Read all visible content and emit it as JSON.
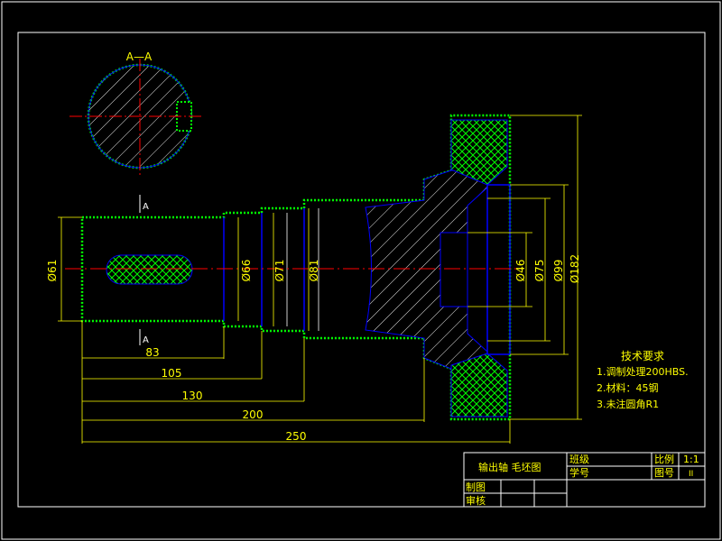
{
  "colors": {
    "background": "#000000",
    "frame": "#ffffff",
    "outline": "#0000ff",
    "fill_hatch": "#ffffff",
    "fill_border": "#00ff00",
    "center_line": "#ff0000",
    "dimension": "#ffff00",
    "title_text": "#ffff00",
    "note_text": "#ffff00"
  },
  "section_view": {
    "label": "A—A"
  },
  "cut_marks": {
    "top_label": "A",
    "bottom_label": "A"
  },
  "diameters": {
    "d61": "Ø61",
    "d66": "Ø66",
    "d71": "Ø71",
    "d81": "Ø81",
    "d46": "Ø46",
    "d75": "Ø75",
    "d99": "Ø99",
    "d182": "Ø182"
  },
  "lengths": {
    "l83": "83",
    "l105": "105",
    "l130": "130",
    "l200": "200",
    "l250": "250"
  },
  "tech_notes": {
    "title": "技术要求",
    "items": [
      "1.调制处理200HBS.",
      "2.材料：45钢",
      "3.未注圆角R1"
    ]
  },
  "title_block": {
    "part_name": "输出轴 毛坯图",
    "class_label": "班级",
    "student_id_label": "学号",
    "scale_label": "比例",
    "scale_value": "1:1",
    "drawing_no_label": "图号",
    "drawing_no_value": "II",
    "drawn_by_label": "制图",
    "checked_by_label": "审核"
  }
}
